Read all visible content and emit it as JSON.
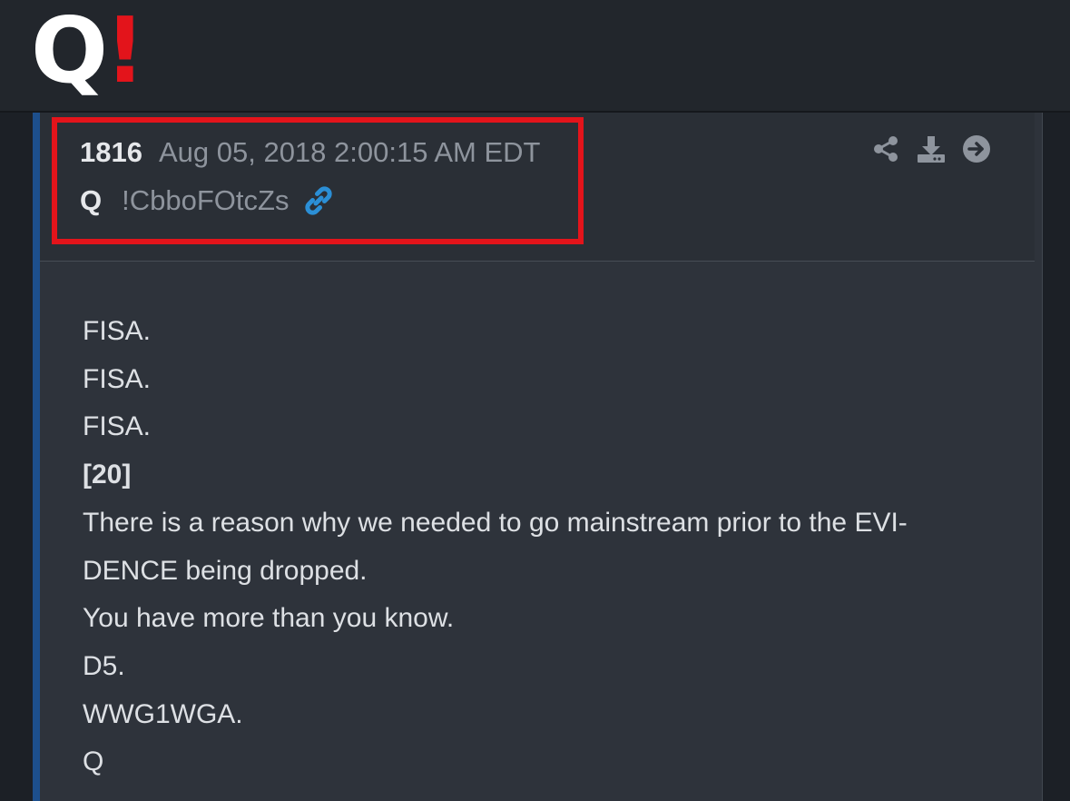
{
  "logo": {
    "letter": "Q",
    "mark": "!",
    "mark_color": "#e3141b"
  },
  "post": {
    "number": "1816",
    "date": "Aug 05, 2018 2:00:15 AM EDT",
    "author": "Q",
    "tripcode": "!CbboFOtcZs",
    "highlight_color": "#e3141b",
    "accent_color": "#1d4f8c",
    "link_icon": "link-icon",
    "link_color": "#2b8fd6",
    "actions": [
      {
        "icon": "share-icon"
      },
      {
        "icon": "download-icon"
      },
      {
        "icon": "arrow-right-circle-icon"
      }
    ],
    "body_lines": [
      {
        "text": "FISA.",
        "bold": false
      },
      {
        "text": "FISA.",
        "bold": false
      },
      {
        "text": "FISA.",
        "bold": false
      },
      {
        "text": "[20]",
        "bold": true
      },
      {
        "text": "There is a reason why we needed to go mainstream prior to the EVI-",
        "bold": false
      },
      {
        "text": "DENCE being dropped.",
        "bold": false
      },
      {
        "text": "You have more than you know.",
        "bold": false
      },
      {
        "text": "D5.",
        "bold": false
      },
      {
        "text": "WWG1WGA.",
        "bold": false
      },
      {
        "text": "Q",
        "bold": false
      }
    ]
  }
}
